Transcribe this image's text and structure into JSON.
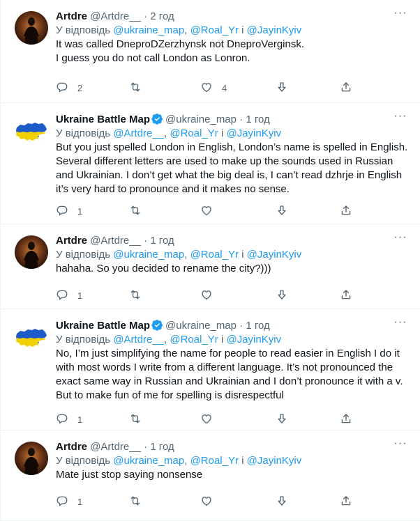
{
  "tweets": [
    {
      "name": "Artdre",
      "handle": "@Artdre__",
      "dot": "·",
      "time": "2 год",
      "verified": false,
      "avatar": "dark-silhouette",
      "reply_prefix": "У відповідь",
      "mentions": [
        "@ukraine_map",
        "@Roal_Yr",
        "@JayinKyiv"
      ],
      "sep1": ",",
      "sep2": "і",
      "lines": [
        "It was called DneproDZerzhynsk not DneproVerginsk.",
        "I guess you do not call London as Lonron."
      ],
      "reply_count": "2",
      "retweet_count": "",
      "like_count": "4"
    },
    {
      "name": "Ukraine Battle Map",
      "handle": "@ukraine_map",
      "dot": "·",
      "time": "1 год",
      "verified": true,
      "avatar": "ukraine-map",
      "reply_prefix": "У відповідь",
      "mentions": [
        "@Artdre__",
        "@Roal_Yr",
        "@JayinKyiv"
      ],
      "sep1": ",",
      "sep2": "і",
      "lines": [
        "But you just spelled London in English, London’s name is spelled in English.",
        "Several different letters are used to make up the sounds used in Russian",
        "and Ukrainian. I don’t get what the big deal is, I can’t read dzhrje in English",
        "it’s very hard to pronounce and it makes no sense."
      ],
      "reply_count": "1",
      "retweet_count": "",
      "like_count": ""
    },
    {
      "name": "Artdre",
      "handle": "@Artdre__",
      "dot": "·",
      "time": "1 год",
      "verified": false,
      "avatar": "dark-silhouette",
      "reply_prefix": "У відповідь",
      "mentions": [
        "@ukraine_map",
        "@Roal_Yr",
        "@JayinKyiv"
      ],
      "sep1": ",",
      "sep2": "і",
      "lines": [
        "hahaha. So you decided to rename the city?)))"
      ],
      "reply_count": "1",
      "retweet_count": "",
      "like_count": ""
    },
    {
      "name": "Ukraine Battle Map",
      "handle": "@ukraine_map",
      "dot": "·",
      "time": "1 год",
      "verified": true,
      "avatar": "ukraine-map",
      "reply_prefix": "У відповідь",
      "mentions": [
        "@Artdre__",
        "@Roal_Yr",
        "@JayinKyiv"
      ],
      "sep1": ",",
      "sep2": "і",
      "lines": [
        "No, I’m just simplifying the name for people to read easier in English I do it",
        "with most words I write from a different language. It’s not pronounced the",
        "exact same way in Russian and Ukrainian and I don’t pronounce it with a v.",
        "But to make fun of me for spelling is disrespectful"
      ],
      "reply_count": "1",
      "retweet_count": "",
      "like_count": ""
    },
    {
      "name": "Artdre",
      "handle": "@Artdre__",
      "dot": "·",
      "time": "1 год",
      "verified": false,
      "avatar": "dark-silhouette",
      "reply_prefix": "У відповідь",
      "mentions": [
        "@ukraine_map",
        "@Roal_Yr",
        "@JayinKyiv"
      ],
      "sep1": ",",
      "sep2": "і",
      "lines": [
        "Mate just stop saying nonsense"
      ],
      "reply_count": "1",
      "retweet_count": "",
      "like_count": ""
    }
  ],
  "icons": {
    "more": "more-horizontal-icon",
    "verified": "verified-badge-icon",
    "reply": "reply-icon",
    "retweet": "retweet-icon",
    "like": "like-icon",
    "dislike": "downvote-icon",
    "share": "share-icon"
  },
  "colors": {
    "text": "#0f1419",
    "secondary": "#536471",
    "link": "#1d9bf0",
    "verified": "#1d9bf0",
    "divider": "#eff3f4",
    "ukraine_blue": "#1c5bc9",
    "ukraine_yellow": "#f5d000"
  }
}
